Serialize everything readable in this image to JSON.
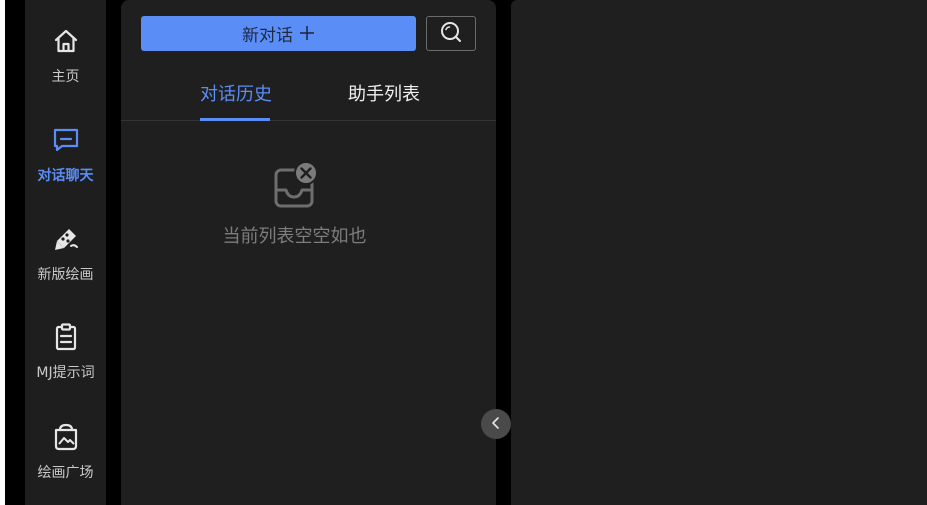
{
  "colors": {
    "accent": "#5b8df7",
    "background": "#000000",
    "panel": "#1f1f1f",
    "muted_text": "#7d7d7d"
  },
  "nav": {
    "items": [
      {
        "label": "主页",
        "icon": "home-icon",
        "active": false
      },
      {
        "label": "对话聊天",
        "icon": "chat-bubble-icon",
        "active": true
      },
      {
        "label": "新版绘画",
        "icon": "paint-brush-icon",
        "active": false
      },
      {
        "label": "MJ提示词",
        "icon": "clipboard-icon",
        "active": false
      },
      {
        "label": "绘画广场",
        "icon": "gallery-bag-icon",
        "active": false
      }
    ]
  },
  "panel": {
    "new_chat_label": "新对话",
    "new_chat_icon": "plus-icon",
    "search_icon": "search-icon",
    "tabs": [
      {
        "label": "对话历史",
        "active": true
      },
      {
        "label": "助手列表",
        "active": false
      }
    ],
    "empty_text": "当前列表空空如也",
    "empty_icon": "empty-inbox-icon"
  },
  "collapse_icon": "chevron-left-icon"
}
